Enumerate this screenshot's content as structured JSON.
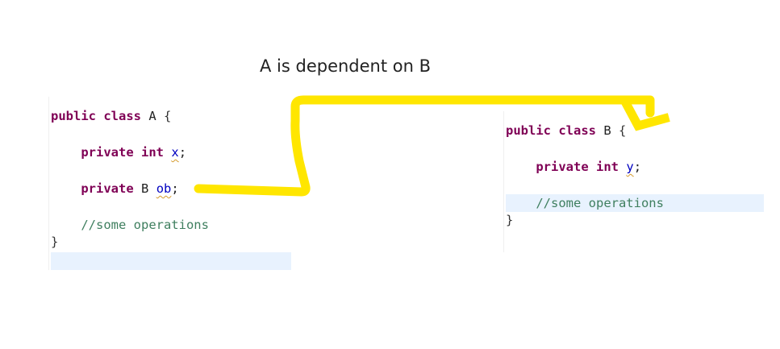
{
  "title": "A is dependent on B",
  "class_a": {
    "line1": {
      "kw1": "public",
      "kw2": "class",
      "name": "A",
      "brace": "{"
    },
    "line2": {
      "kw1": "private",
      "kw2": "int",
      "field": "x",
      "semi": ";"
    },
    "line3": {
      "kw1": "private",
      "type": "B",
      "field": "ob",
      "semi": ";"
    },
    "comment": "//some operations",
    "close": "}"
  },
  "class_b": {
    "line1": {
      "kw1": "public",
      "kw2": "class",
      "name": "B",
      "brace": "{"
    },
    "line2": {
      "kw1": "private",
      "kw2": "int",
      "field": "y",
      "semi": ";"
    },
    "comment": "//some operations",
    "close": "}"
  },
  "colors": {
    "keyword": "#7f0055",
    "field": "#0000c0",
    "comment": "#3f7f5f",
    "arrow": "#ffe600",
    "current_line_highlight": "#e8f2fe"
  }
}
